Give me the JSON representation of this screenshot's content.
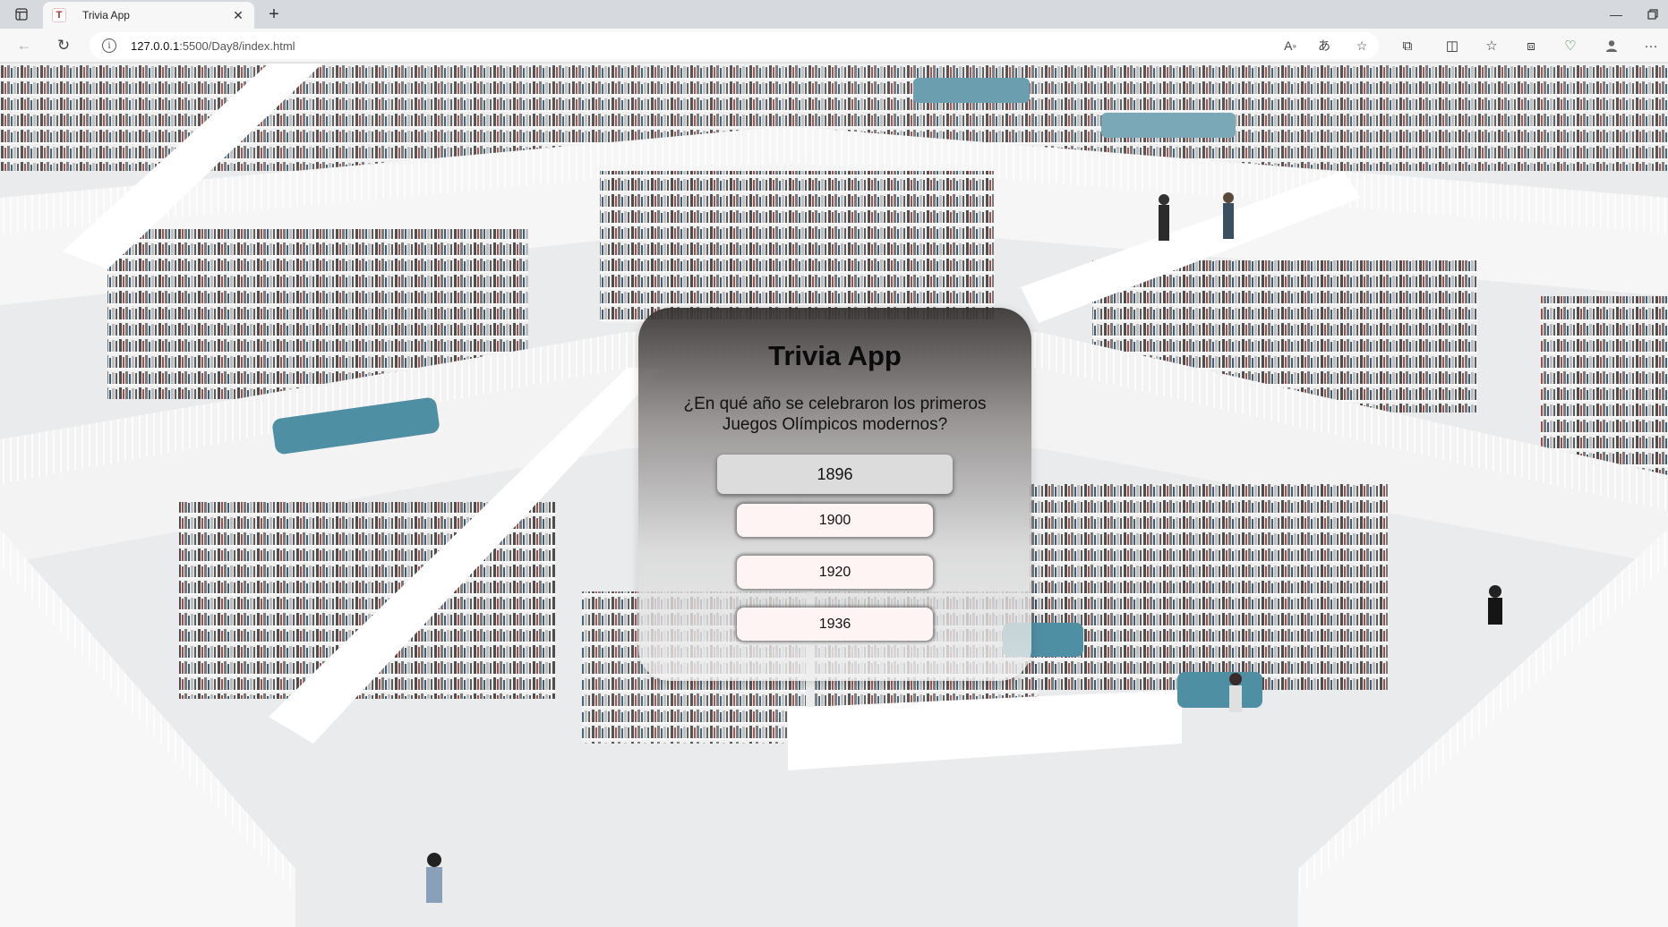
{
  "browser": {
    "tab": {
      "title": "Trivia App",
      "favicon_letter": "T"
    },
    "address": {
      "host": "127.0.0.1",
      "path": ":5500/Day8/index.html"
    }
  },
  "page": {
    "title": "Trivia App",
    "question": "¿En qué año se celebraron los primeros Juegos Olímpicos modernos?",
    "options": [
      "1896",
      "1900",
      "1920",
      "1936"
    ],
    "highlighted_option": "1896"
  },
  "colors": {
    "option_background": "#fff4f4",
    "highlighted_option_background": "#dcdcdc",
    "card_top": "#373232",
    "card_bottom": "#f0f0f0"
  },
  "icons": {
    "sidebar_toggle": "sidebar-icon",
    "close_tab": "close-icon",
    "new_tab": "plus-icon",
    "back": "back-arrow-icon",
    "reload": "reload-icon",
    "site_info": "info-icon",
    "read_aloud": "read-aloud-icon",
    "translate": "translate-icon",
    "favorite": "star-icon",
    "extensions": "puzzle-icon",
    "split_screen": "split-screen-icon",
    "favorites": "favorites-list-icon",
    "collections": "collections-icon",
    "browser_essentials": "heart-pulse-icon",
    "profile": "profile-icon",
    "more": "more-icon",
    "minimize": "minimize-icon",
    "restore": "restore-icon"
  }
}
